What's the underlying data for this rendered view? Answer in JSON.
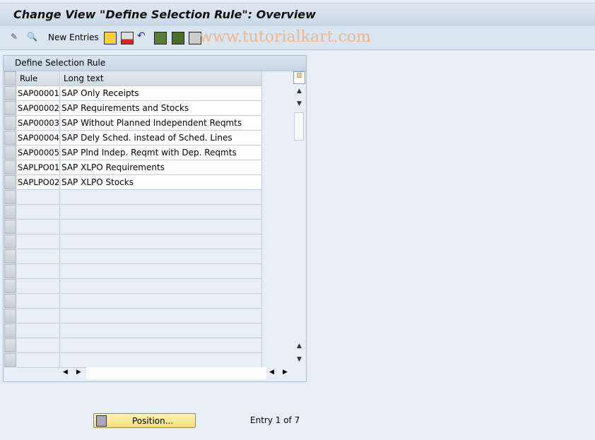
{
  "title": "Change View \"Define Selection Rule\": Overview",
  "toolbar": {
    "new_entries": "New Entries",
    "icons": [
      "change-display-icon",
      "find-icon",
      "copy-icon",
      "delete-icon",
      "undo-icon",
      "select-all-icon",
      "select-block-icon",
      "deselect-all-icon"
    ]
  },
  "watermark": "www.tutorialkart.com",
  "table": {
    "title": "Define Selection Rule",
    "columns": [
      "Rule",
      "Long text"
    ],
    "rows": [
      [
        "SAP00001",
        "SAP Only Receipts"
      ],
      [
        "SAP00002",
        "SAP Requirements and Stocks"
      ],
      [
        "SAP00003",
        "SAP Without Planned Independent Reqmts"
      ],
      [
        "SAP00004",
        "SAP Dely Sched. instead of Sched. Lines"
      ],
      [
        "SAP00005",
        "SAP Plnd Indep. Reqmt with Dep. Reqmts"
      ],
      [
        "SAPLPO01",
        "SAP XLPO Requirements"
      ],
      [
        "SAPLPO02",
        "SAP XLPO Stocks"
      ]
    ]
  },
  "footer": {
    "position_button": "Position...",
    "entry_text": "Entry 1 of 7"
  }
}
